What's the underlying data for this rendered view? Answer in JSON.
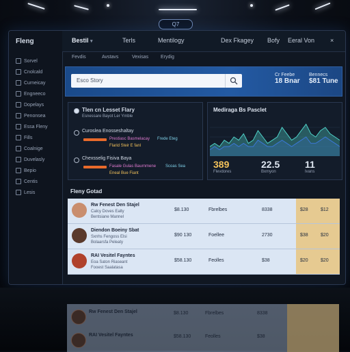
{
  "top_pill": "Q7",
  "sidebar": {
    "brand": "Fleng",
    "items": [
      "Sorvel",
      "Cnolcald",
      "Curneicay",
      "Engneeco",
      "Dopelays",
      "Penonsea",
      "Essa Fleny",
      "Fills",
      "Coalnige",
      "Duvelasly",
      "Bepio",
      "Centis",
      "Lesis"
    ]
  },
  "topbar": {
    "tabs": [
      "Bestil",
      "Terls",
      "Mentilogy",
      "Dex Fkagey",
      "Bofy",
      "Eeral Von"
    ],
    "close_glyph": "×"
  },
  "subbar": {
    "tabs": [
      "Fevdis",
      "Avstavs",
      "Vexisas",
      "Erydig"
    ]
  },
  "hero": {
    "search_text": "Esco Story",
    "stats": [
      {
        "label": "Cr Feebe",
        "value": "18 Bnar"
      },
      {
        "label": "Bennecs",
        "value": "$81 Tune"
      }
    ]
  },
  "alerts": {
    "title": "Tlen cn Lesset Flary",
    "subtitle": "Esnessare Bayot Ler Ymble",
    "rows": [
      {
        "title": "Curoslea Enosseshaltay",
        "chips": [
          "Prestiasc Basmelacay",
          "Frede Eteg",
          "Flarid Steir E fanl"
        ]
      },
      {
        "title": "Chexsselig Fisiva Baya",
        "chips": [
          "Fasale Gulas Baurnmene",
          "Scoas Sea",
          "Eneal Bue Fiant"
        ]
      }
    ]
  },
  "metrics": {
    "title": "Mediraga Bs Pasclet",
    "stats": [
      {
        "value": "389",
        "label": "Flevdores"
      },
      {
        "value": "22.5",
        "label": "Bxmyon"
      },
      {
        "value": "11",
        "label": "Ivans"
      }
    ]
  },
  "chart_data": {
    "type": "line",
    "title": "Mediraga Bs Pasclet",
    "series": [
      {
        "values": [
          3,
          4,
          3,
          5,
          4,
          6,
          5,
          7,
          4,
          5,
          8,
          6,
          4,
          5,
          6,
          9,
          7,
          5,
          6,
          8,
          10,
          7,
          6,
          8,
          9,
          7,
          6,
          5
        ]
      },
      {
        "values": [
          2,
          3,
          2,
          3,
          3,
          4,
          3,
          4,
          3,
          3,
          5,
          4,
          3,
          3,
          4,
          5,
          4,
          3,
          4,
          5,
          6,
          4,
          4,
          5,
          6,
          5,
          4,
          3
        ]
      }
    ],
    "ylim": [
      0,
      12
    ],
    "grid": true
  },
  "table": {
    "title": "Fleny Gotad",
    "rows": [
      {
        "name": "Rw Fenest Den Stajel",
        "sub": "Calcy Doves Ealty",
        "sub2": "Bentsiane Mannel",
        "c1": "$8.130",
        "c2": "Fbrelbes",
        "c3": "8338",
        "c4": "$28",
        "c5": "$12"
      },
      {
        "name": "Diendon Boeiny Sbat",
        "sub": "Sxnhs Fengoss Elsi",
        "sub2": "Bolaarsfa Peleaty",
        "c1": "$90 130",
        "c2": "Foellee",
        "c3": "2730",
        "c4": "$38",
        "c5": "$20"
      },
      {
        "name": "RAI Vesitel Fayntes",
        "sub": "Eoa Saton Riaseant",
        "sub2": "Fooest Saalatasa",
        "c1": "$58.130",
        "c2": "Feolles",
        "c3": "$38",
        "c4": "$20",
        "c5": "$20"
      }
    ]
  }
}
